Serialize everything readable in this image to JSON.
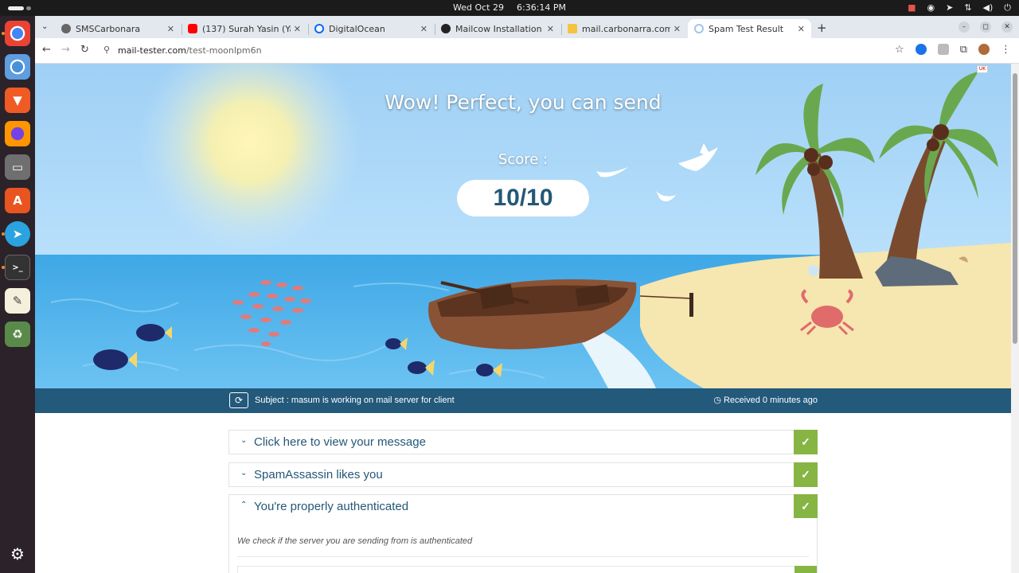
{
  "system": {
    "date": "Wed Oct 29",
    "time": "6:36:14 PM"
  },
  "browser": {
    "tabs": [
      {
        "label": "SMSCarbonara",
        "favicon": "globe-icon"
      },
      {
        "label": "(137) Surah Yasin (Yasee",
        "favicon": "youtube-icon"
      },
      {
        "label": "DigitalOcean",
        "favicon": "digitalocean-icon"
      },
      {
        "label": "Mailcow Installation Serv",
        "favicon": "github-icon"
      },
      {
        "label": "mail.carbonarra.com - m",
        "favicon": "mail-icon"
      },
      {
        "label": "Spam Test Result",
        "favicon": "loading-icon"
      }
    ],
    "active_tab": 5,
    "url_domain": "mail-tester.com",
    "url_path": "/test-moonlpm6n"
  },
  "hero": {
    "headline": "Wow! Perfect, you can send",
    "score_label": "Score :",
    "score": "10/10"
  },
  "subject_bar": {
    "subject": "Subject : masum is working on mail server for client",
    "received": "Received 0 minutes ago"
  },
  "results": [
    {
      "title": "Click here to view your message",
      "status": "pass",
      "expanded": false
    },
    {
      "title": "SpamAssassin likes you",
      "status": "pass",
      "expanded": false
    },
    {
      "title": "You're properly authenticated",
      "status": "pass",
      "expanded": true,
      "description": "We check if the server you are sending from is authenticated"
    }
  ],
  "colors": {
    "accent": "#245877",
    "success": "#86b543",
    "subject_bar": "#23597b"
  }
}
